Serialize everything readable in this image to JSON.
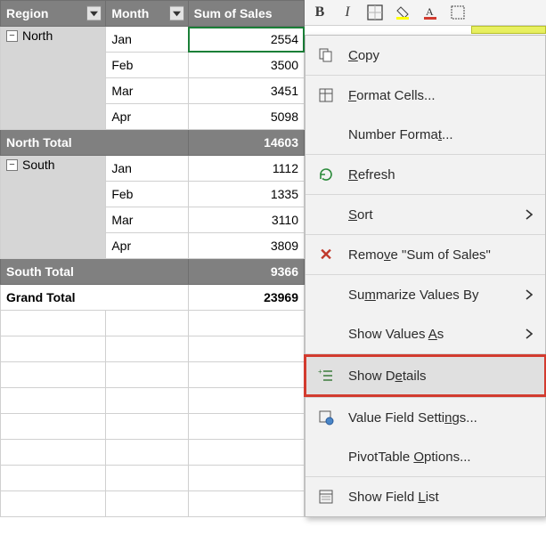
{
  "headers": {
    "region": "Region",
    "month": "Month",
    "sales": "Sum of Sales"
  },
  "groups": [
    {
      "region": "North",
      "rows": [
        {
          "month": "Jan",
          "sales": "2554"
        },
        {
          "month": "Feb",
          "sales": "3500"
        },
        {
          "month": "Mar",
          "sales": "3451"
        },
        {
          "month": "Apr",
          "sales": "5098"
        }
      ],
      "subtotal_label": "North Total",
      "subtotal": "14603"
    },
    {
      "region": "South",
      "rows": [
        {
          "month": "Jan",
          "sales": "1112"
        },
        {
          "month": "Feb",
          "sales": "1335"
        },
        {
          "month": "Mar",
          "sales": "3110"
        },
        {
          "month": "Apr",
          "sales": "3809"
        }
      ],
      "subtotal_label": "South Total",
      "subtotal": "9366"
    }
  ],
  "grand": {
    "label": "Grand Total",
    "value": "23969"
  },
  "ctx": {
    "copy": "Copy",
    "format_cells": "Format Cells...",
    "number_format": "Number Format...",
    "refresh": "Refresh",
    "sort": "Sort",
    "remove": "Remove \"Sum of Sales\"",
    "summarize": "Summarize Values By",
    "show_values_as": "Show Values As",
    "show_details": "Show Details",
    "value_field_settings": "Value Field Settings...",
    "pivot_options": "PivotTable Options...",
    "show_field_list": "Show Field List"
  },
  "chart_data": {
    "type": "table",
    "title": "PivotTable — Sum of Sales by Region and Month",
    "columns": [
      "Region",
      "Month",
      "Sum of Sales"
    ],
    "rows": [
      [
        "North",
        "Jan",
        2554
      ],
      [
        "North",
        "Feb",
        3500
      ],
      [
        "North",
        "Mar",
        3451
      ],
      [
        "North",
        "Apr",
        5098
      ],
      [
        "North Total",
        "",
        14603
      ],
      [
        "South",
        "Jan",
        1112
      ],
      [
        "South",
        "Feb",
        1335
      ],
      [
        "South",
        "Mar",
        3110
      ],
      [
        "South",
        "Apr",
        3809
      ],
      [
        "South Total",
        "",
        9366
      ],
      [
        "Grand Total",
        "",
        23969
      ]
    ]
  }
}
